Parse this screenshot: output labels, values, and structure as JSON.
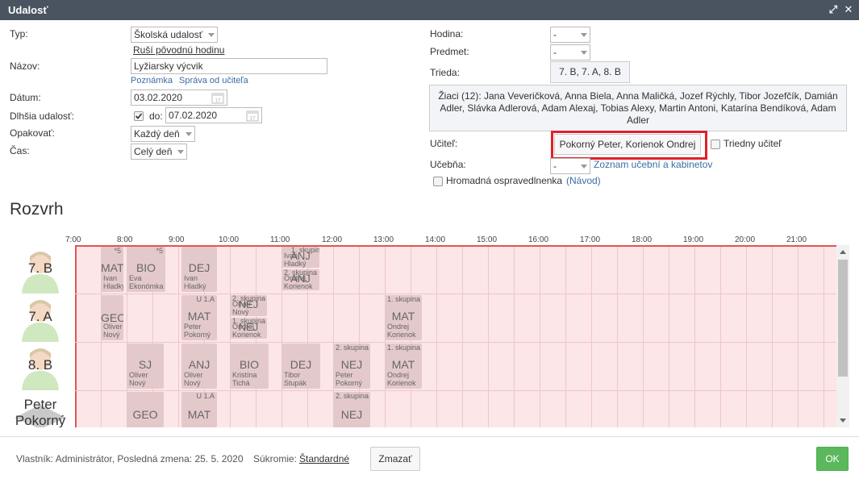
{
  "window": {
    "title": "Udalosť"
  },
  "form": {
    "typ": {
      "label": "Typ:",
      "value": "Školská udalosť",
      "link": "Ruší pôvodnú hodinu"
    },
    "nazov": {
      "label": "Názov:",
      "value": "Lyžiarsky výcvik",
      "links": [
        "Poznámka",
        "Správa od učiteľa"
      ]
    },
    "datum": {
      "label": "Dátum:",
      "value": "03.02.2020"
    },
    "dlhsia": {
      "label": "Dlhšia udalosť:",
      "checked": true,
      "do_label": "do:",
      "do_value": "07.02.2020"
    },
    "opakovat": {
      "label": "Opakovať:",
      "value": "Každý deň"
    },
    "cas": {
      "label": "Čas:",
      "value": "Celý deň"
    },
    "hodina": {
      "label": "Hodina:",
      "value": "-"
    },
    "predmet": {
      "label": "Predmet:",
      "value": "-"
    },
    "trieda": {
      "label": "Trieda:",
      "value": "7. B, 7. A, 8. B"
    },
    "ziaci": {
      "text": "Žiaci (12): Jana Veveričková, Anna Biela, Anna Maličká, Jozef Rýchly, Tibor Jozefčík, Damián Adler, Slávka Adlerová, Adam Alexaj, Tobias Alexy, Martin Antoni, Katarína Bendíková, Adam Adler"
    },
    "ucitel": {
      "label": "Učiteľ:",
      "value": "Pokorný Peter, Korienok Ondrej",
      "triedny_label": "Triedny učiteľ",
      "triedny_checked": false,
      "highlight": "#e0202a"
    },
    "ucebna": {
      "label": "Učebňa:",
      "value": "-",
      "link": "Zoznam učební a kabinetov"
    },
    "hromadna": {
      "label": "Hromadná ospravedlnenka",
      "link": "(Návod)",
      "checked": false
    }
  },
  "timetable": {
    "title": "Rozvrh",
    "hours": [
      "7:00",
      "8:00",
      "9:00",
      "10:00",
      "11:00",
      "12:00",
      "13:00",
      "14:00",
      "15:00",
      "16:00",
      "17:00",
      "18:00",
      "19:00",
      "20:00",
      "21:00"
    ],
    "rows": [
      "7. B",
      "7. A",
      "8. B",
      "Peter Pokorný"
    ],
    "lessons": {
      "b7_mat": {
        "subject": "MAT",
        "teacher": "Ivan\nHladký",
        "mark": "*5"
      },
      "b7_bio": {
        "subject": "BIO",
        "teacher": "Eva\nEkonómka",
        "mark": "*5"
      },
      "b7_dej": {
        "subject": "DEJ",
        "teacher": "Ivan\nHladký"
      },
      "b7_anj": {
        "subject": "ANJ",
        "teacher": "Ivan\nHladký",
        "group": "1. skupina"
      },
      "b7_anj2": {
        "subject": "ANJ",
        "teacher": "Ondrej\nKorienok",
        "group": "2. skupina"
      },
      "a7_geo": {
        "subject": "GEO",
        "teacher": "Oliver\nNový"
      },
      "a7_mat": {
        "subject": "MAT",
        "teacher": "Peter\nPokorný",
        "mark": "U 1.A"
      },
      "a7_nej1": {
        "subject": "NEJ",
        "teacher": "Oliver\nNový",
        "group": "2. skupina"
      },
      "a7_nej2": {
        "subject": "NEJ",
        "teacher": "Ondrej\nKorienok",
        "group": "1. skupina"
      },
      "a7_mat2": {
        "subject": "MAT",
        "teacher": "Ondrej\nKorienok",
        "group": "1. skupina"
      },
      "b8_sj": {
        "subject": "SJ",
        "teacher": "Oliver\nNový"
      },
      "b8_anj": {
        "subject": "ANJ",
        "teacher": "Oliver\nNový"
      },
      "b8_bio": {
        "subject": "BIO",
        "teacher": "Kristína\nTichá"
      },
      "b8_dej": {
        "subject": "DEJ",
        "teacher": "Tibor\nStupák"
      },
      "b8_nej": {
        "subject": "NEJ",
        "teacher": "Peter\nPokorný",
        "group": "2. skupina"
      },
      "b8_mat": {
        "subject": "MAT",
        "teacher": "Ondrej\nKorienok",
        "group": "1. skupina"
      },
      "p_geo": {
        "subject": "GEO"
      },
      "p_mat": {
        "subject": "MAT",
        "mark": "U 1.A"
      },
      "p_nej": {
        "subject": "NEJ",
        "group": "2. skupina"
      }
    }
  },
  "footer": {
    "owner": "Vlastník: Administrátor, Posledná zmena: 25. 5. 2020",
    "sukromie_label": "Súkromie:",
    "sukromie_value": "Štandardné",
    "delete": "Zmazať",
    "ok": "OK"
  }
}
